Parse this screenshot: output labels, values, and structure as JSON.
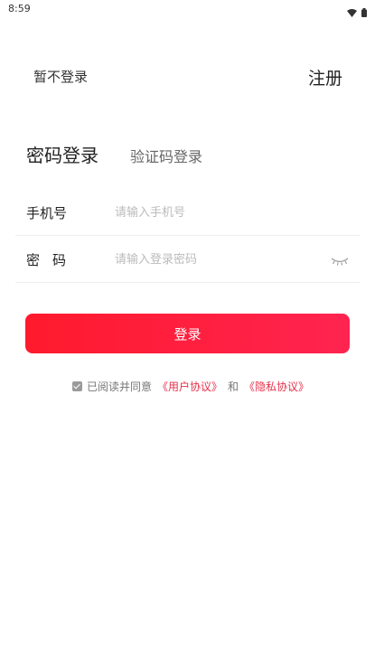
{
  "status_bar": {
    "time": "8:59",
    "icons": [
      "wifi-icon",
      "battery-icon"
    ]
  },
  "header": {
    "skip_login": "暂不登录",
    "register": "注册"
  },
  "tabs": {
    "password_login": "密码登录",
    "code_login": "验证码登录"
  },
  "form": {
    "phone_label": "手机号",
    "phone_placeholder": "请输入手机号",
    "phone_value": "",
    "password_label": "密码",
    "password_placeholder": "请输入登录密码",
    "password_value": ""
  },
  "login_button": "登录",
  "agreement": {
    "checked": true,
    "prefix": "已阅读并同意",
    "user_agreement": "《用户协议》",
    "and": "和",
    "privacy_policy": "《隐私协议》"
  },
  "colors": {
    "accent": "#ff1a2d",
    "link": "#e8304a"
  }
}
